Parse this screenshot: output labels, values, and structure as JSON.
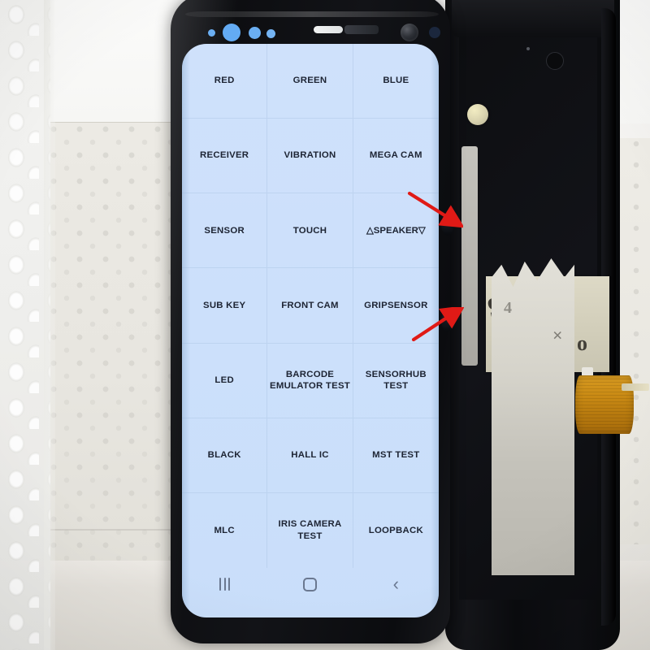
{
  "scene": {
    "description": "Samsung Galaxy phone displaying hardware diagnostic test menu",
    "background_label": "bubble-wrap and styrofoam packing"
  },
  "phone": {
    "screen": {
      "background_color": "#cce0fb",
      "text_color": "#1d2433",
      "grid": {
        "columns": 3,
        "rows": 7,
        "cells": [
          {
            "label": "RED"
          },
          {
            "label": "GREEN"
          },
          {
            "label": "BLUE"
          },
          {
            "label": "RECEIVER"
          },
          {
            "label": "VIBRATION"
          },
          {
            "label": "MEGA CAM"
          },
          {
            "label": "SENSOR"
          },
          {
            "label": "TOUCH"
          },
          {
            "label": "△SPEAKER▽"
          },
          {
            "label": "SUB KEY"
          },
          {
            "label": "FRONT CAM"
          },
          {
            "label": "GRIPSENSOR"
          },
          {
            "label": "LED"
          },
          {
            "label": "BARCODE\nEMULATOR TEST"
          },
          {
            "label": "SENSORHUB TEST"
          },
          {
            "label": "BLACK"
          },
          {
            "label": "HALL IC"
          },
          {
            "label": "MST TEST"
          },
          {
            "label": "MLC"
          },
          {
            "label": "IRIS CAMERA\nTEST"
          },
          {
            "label": "LOOPBACK"
          }
        ]
      },
      "navbar": {
        "recents_label": "Recents",
        "home_label": "Home",
        "back_label": "‹"
      }
    },
    "bezel": {
      "sensors_label": "proximity and iris sensors",
      "earpiece_label": "Earpiece speaker",
      "camera_label": "Front camera"
    }
  },
  "annotations": {
    "color": "#e01a16",
    "arrows": [
      {
        "name": "arrow-upper",
        "points_at": "dark defect at right screen edge near SPEAKER row"
      },
      {
        "name": "arrow-lower",
        "points_at": "dark defect at right screen edge near GRIPSENSOR row"
      }
    ]
  },
  "disassembled_frame": {
    "label": "phone mid-frame with masking tape",
    "tape_marks": [
      "9",
      "4",
      "×",
      "o"
    ],
    "flex_cable_label": "orange flex ribbon cable"
  }
}
